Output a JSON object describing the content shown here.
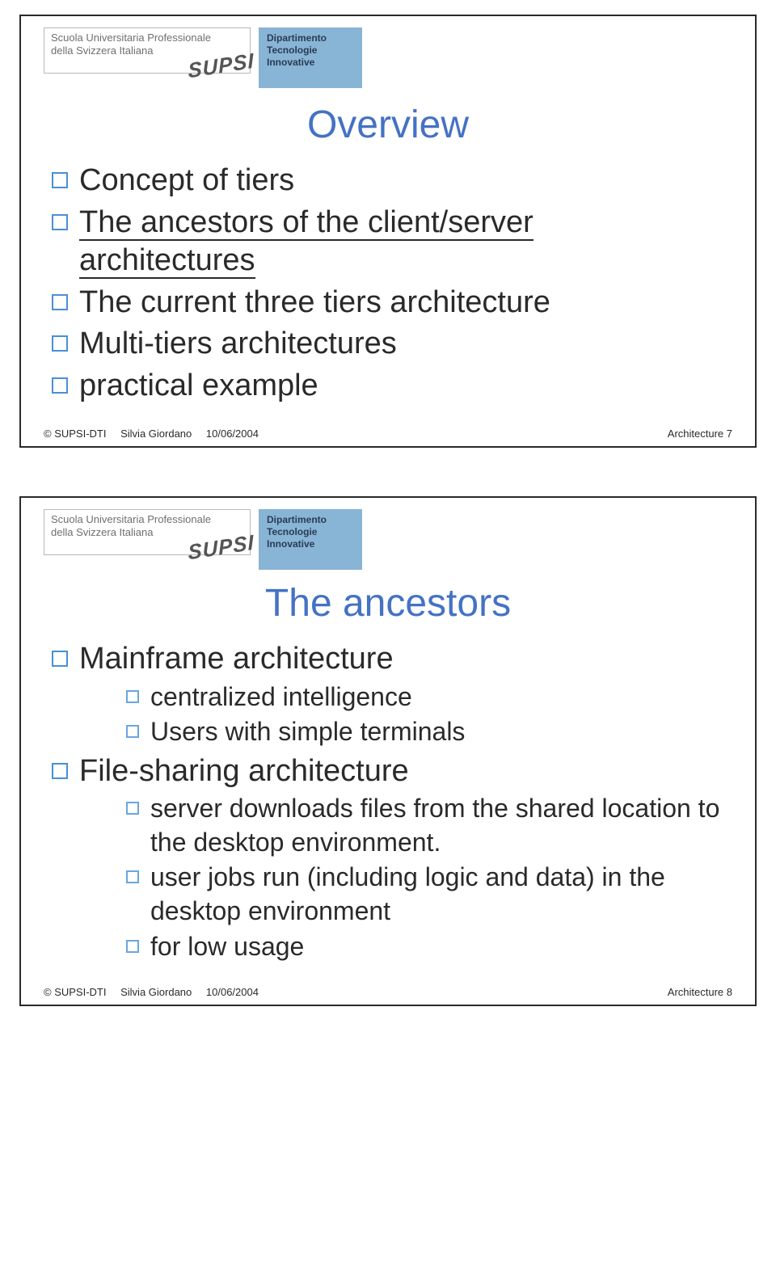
{
  "header": {
    "left_line1": "Scuola Universitaria Professionale",
    "left_line2": "della Svizzera Italiana",
    "stamp": "SUPSI",
    "mid_line1": "Dipartimento",
    "mid_line2": "Tecnologie",
    "mid_line3": "Innovative"
  },
  "slide1": {
    "title": "Overview",
    "items": {
      "i1": "Concept of tiers",
      "i2a": "The ancestors of the client/server",
      "i2b": "architectures",
      "i3": "The current three tiers architecture",
      "i4": "Multi-tiers architectures",
      "i5": "practical example"
    },
    "footer": {
      "org": "© SUPSI-DTI",
      "author": "Silvia Giordano",
      "date": "10/06/2004",
      "right": "Architecture 7"
    }
  },
  "slide2": {
    "title": "The ancestors",
    "items": {
      "m": "Mainframe architecture",
      "m1": "centralized intelligence",
      "m2": "Users with simple terminals",
      "f": "File-sharing architecture",
      "f1": "server downloads files from the shared location to the desktop environment.",
      "f2": " user jobs run (including logic and data) in the desktop environment",
      "f3": "for low usage"
    },
    "footer": {
      "org": "© SUPSI-DTI",
      "author": "Silvia Giordano",
      "date": "10/06/2004",
      "right": "Architecture 8"
    }
  }
}
